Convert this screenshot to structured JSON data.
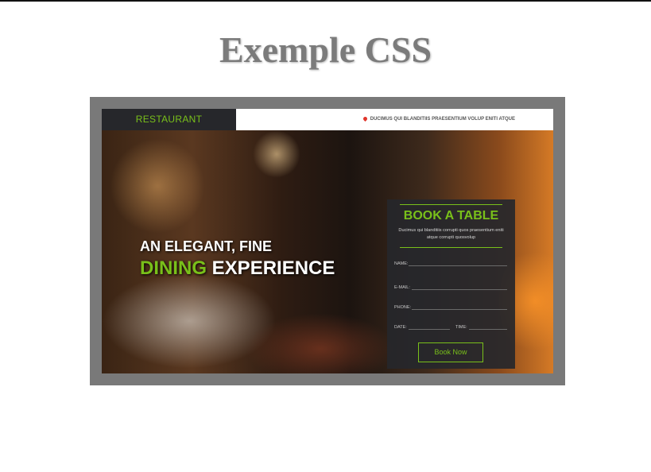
{
  "page": {
    "title": "Exemple CSS"
  },
  "site": {
    "logo": "RESTAURANT",
    "header_info": "DUCIMUS QUI BLANDITIIS PRAESENTIUM VOLUP ENITI ATQUE",
    "hero": {
      "line1": "AN ELEGANT, FINE",
      "accent": "DINING",
      "line2_rest": " EXPERIENCE"
    },
    "booking": {
      "title": "BOOK A TABLE",
      "description": "Ducimus qui blanditiis corrupti quos praesentium eniti atque corrupti quosvolup",
      "fields": {
        "name": "NAME:",
        "email": "E-MAIL:",
        "phone": "PHONE:",
        "date": "DATE:",
        "time": "TIME:"
      },
      "button": "Book Now"
    }
  },
  "colors": {
    "accent": "#79c01a",
    "frame": "#797979",
    "dark": "#26272b"
  },
  "icons": {
    "location": "map-pin-icon"
  }
}
